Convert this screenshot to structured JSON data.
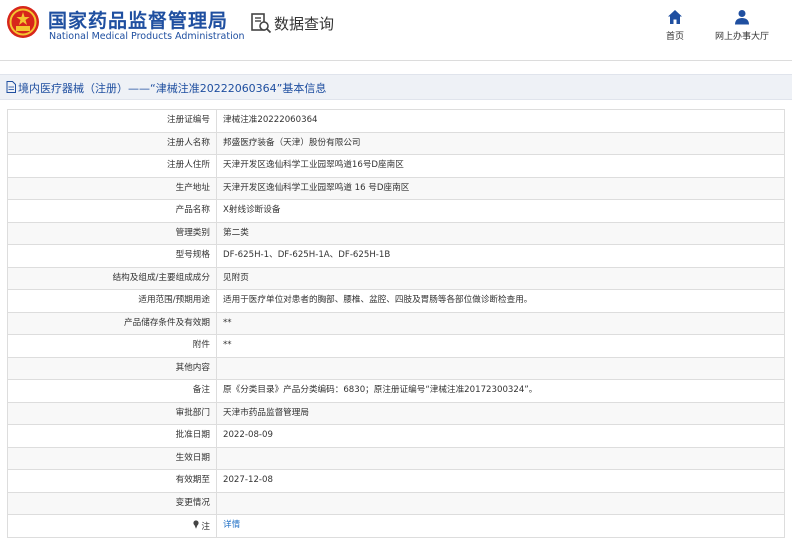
{
  "header": {
    "site_title_cn": "国家药品监督管理局",
    "site_title_en": "National Medical Products Administration",
    "query_label": "数据查询",
    "nav": [
      {
        "label": "首页",
        "icon": "home-icon"
      },
      {
        "label": "网上办事大厅",
        "icon": "user-icon"
      }
    ]
  },
  "title_bar": {
    "text": "境内医疗器械（注册）——“津械注准20222060364”基本信息"
  },
  "rows": [
    {
      "label": "注册证编号",
      "value": "津械注准20222060364"
    },
    {
      "label": "注册人名称",
      "value": "邦盛医疗装备（天津）股份有限公司"
    },
    {
      "label": "注册人住所",
      "value": "天津开发区逸仙科学工业园翠鸣道16号D座南区"
    },
    {
      "label": "生产地址",
      "value": "天津开发区逸仙科学工业园翠鸣道 16 号D座南区"
    },
    {
      "label": "产品名称",
      "value": "X射线诊断设备"
    },
    {
      "label": "管理类别",
      "value": "第二类"
    },
    {
      "label": "型号规格",
      "value": "DF-625H-1、DF-625H-1A、DF-625H-1B"
    },
    {
      "label": "结构及组成/主要组成成分",
      "value": "见附页"
    },
    {
      "label": "适用范围/预期用途",
      "value": "适用于医疗单位对患者的胸部、腰椎、盆腔、四肢及胃肠等各部位做诊断检查用。"
    },
    {
      "label": "产品储存条件及有效期",
      "value": "**"
    },
    {
      "label": "附件",
      "value": "**"
    },
    {
      "label": "其他内容",
      "value": ""
    },
    {
      "label": "备注",
      "value": "原《分类目录》产品分类编码：6830；原注册证编号“津械注准20172300324”。"
    },
    {
      "label": "审批部门",
      "value": "天津市药品监督管理局"
    },
    {
      "label": "批准日期",
      "value": "2022-08-09"
    },
    {
      "label": "生效日期",
      "value": ""
    },
    {
      "label": "有效期至",
      "value": "2027-12-08"
    },
    {
      "label": "变更情况",
      "value": ""
    }
  ],
  "note_row": {
    "label": "注",
    "pin_icon": "pin-icon",
    "link_text": "详情"
  }
}
